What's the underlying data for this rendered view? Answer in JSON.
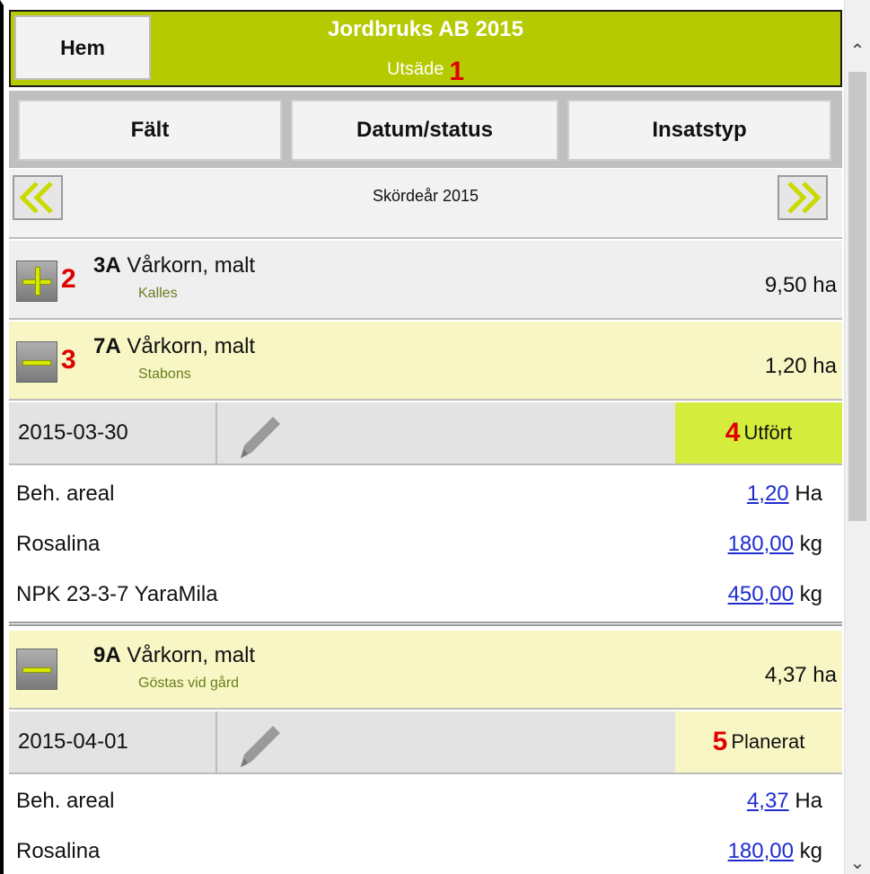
{
  "header": {
    "home_label": "Hem",
    "title": "Jordbruks AB 2015",
    "subtitle": "Utsäde",
    "marker": "1",
    "color": "#b5ca00"
  },
  "nav": {
    "tabs": [
      {
        "label": "Fält"
      },
      {
        "label": "Datum/status"
      },
      {
        "label": "Insatstyp"
      }
    ]
  },
  "year": {
    "label": "Skördeår 2015",
    "prev_icon": "double-chevron-left-icon",
    "next_icon": "double-chevron-right-icon"
  },
  "fields": [
    {
      "marker": "2",
      "code": "3A",
      "crop": "Vårkorn, malt",
      "place": "Kalles",
      "area": "9,50 ha",
      "state": "collapsed"
    },
    {
      "marker": "3",
      "code": "7A",
      "crop": "Vårkorn, malt",
      "place": "Stabons",
      "area": "1,20 ha",
      "state": "expanded",
      "activity": {
        "date": "2015-03-30",
        "status_marker": "4",
        "status": "Utfört",
        "lines": [
          {
            "label": "Beh. areal",
            "value": "1,20",
            "unit": "Ha"
          },
          {
            "label": "Rosalina",
            "value": "180,00",
            "unit": "kg"
          },
          {
            "label": "NPK 23-3-7 YaraMila",
            "value": "450,00",
            "unit": "kg"
          }
        ]
      }
    },
    {
      "marker": "",
      "code": "9A",
      "crop": "Vårkorn, malt",
      "place": "Göstas vid gård",
      "area": "4,37 ha",
      "state": "expanded",
      "activity": {
        "date": "2015-04-01",
        "status_marker": "5",
        "status": "Planerat",
        "lines": [
          {
            "label": "Beh. areal",
            "value": "4,37",
            "unit": "Ha"
          },
          {
            "label": "Rosalina",
            "value": "180,00",
            "unit": "kg"
          }
        ]
      }
    }
  ],
  "colors": {
    "status_done": "#d4ed3c",
    "status_planned": "#f7f6c4",
    "link": "#1f2ccf",
    "marker": "#e10000"
  }
}
